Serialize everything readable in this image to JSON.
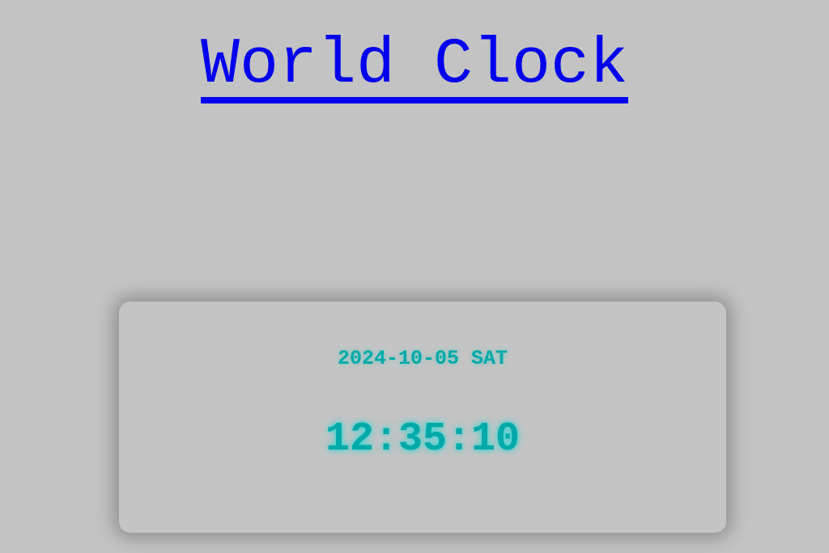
{
  "header": {
    "title": "World Clock"
  },
  "clock": {
    "date": "2024-10-05 SAT",
    "time": "12:35:10"
  },
  "colors": {
    "background": "#c3c3c3",
    "link": "#0000ee",
    "clock_text": "#00a9a9"
  }
}
